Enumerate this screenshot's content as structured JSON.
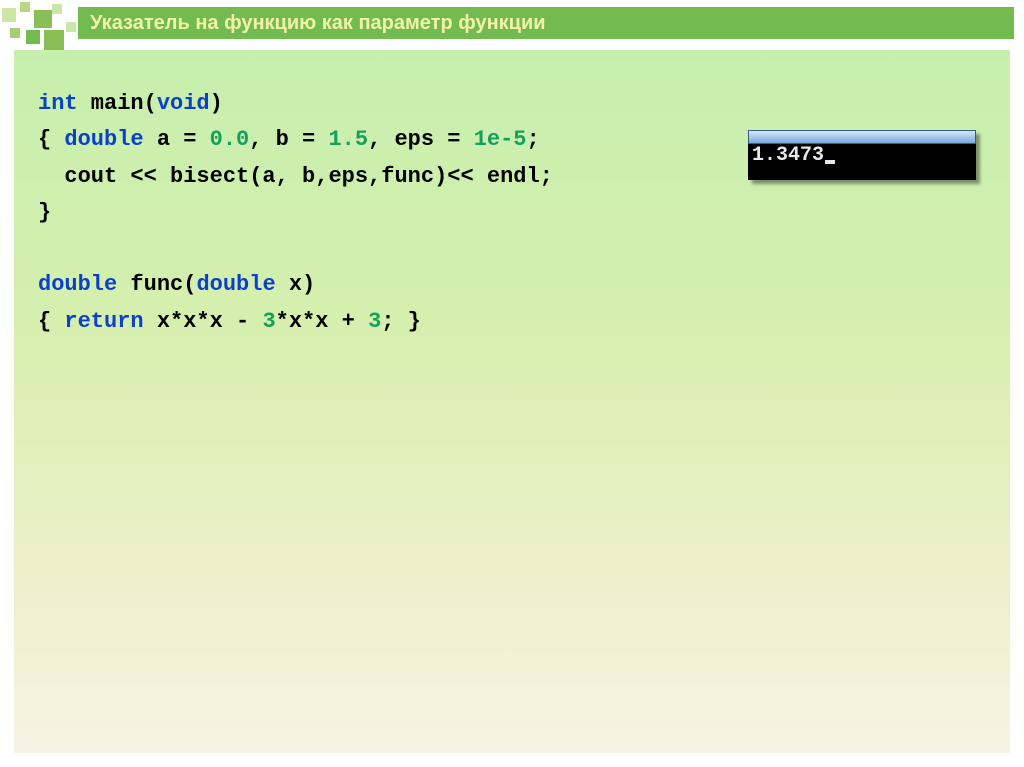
{
  "title": "Указатель на функцию как параметр функции",
  "code": {
    "l1": {
      "kw1": "int",
      "t1": " main(",
      "kw2": "void",
      "t2": ")"
    },
    "l2": {
      "t1": "{ ",
      "kw1": "double",
      "t2": " a = ",
      "n1": "0.0",
      "t3": ", b = ",
      "n2": "1.5",
      "t4": ", eps = ",
      "n3": "1e-5",
      "t5": ";"
    },
    "l3": {
      "t1": "  cout << bisect(a, b,eps,func)<< endl;"
    },
    "l4": {
      "t1": "}"
    },
    "l5": {
      "kw1": "double",
      "t1": " func(",
      "kw2": "double",
      "t2": " x)"
    },
    "l6": {
      "t1": "{ ",
      "kw1": "return",
      "t2": " x*x*x - ",
      "n1": "3",
      "t3": "*x*x + ",
      "n2": "3",
      "t4": "; }"
    }
  },
  "console": {
    "output": "1.3473"
  }
}
